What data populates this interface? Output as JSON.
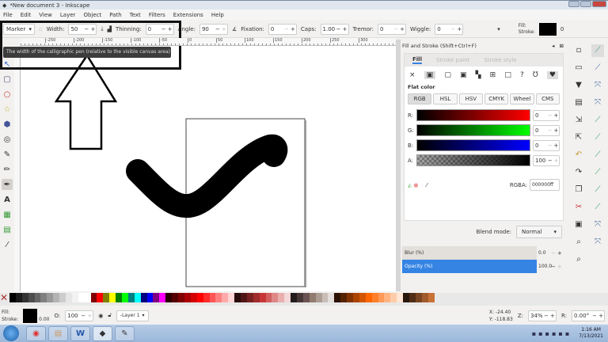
{
  "window": {
    "title": "*New document 3 - Inkscape"
  },
  "menu": [
    "File",
    "Edit",
    "View",
    "Layer",
    "Object",
    "Path",
    "Text",
    "Filters",
    "Extensions",
    "Help"
  ],
  "toolbar": {
    "preset": "Marker",
    "width_label": "Width:",
    "width": "50",
    "thinning_label": "Thinning:",
    "thinning": "0",
    "angle_label": "Angle:",
    "angle": "90",
    "fixation_label": "Fixation:",
    "fixation": "0",
    "caps_label": "Caps:",
    "caps": "1.00",
    "tremor_label": "Tremor:",
    "tremor": "0",
    "wiggle_label": "Wiggle:",
    "wiggle": "0",
    "fill_label": "Fill:",
    "stroke_label": "Stroke:",
    "stroke_value": "0"
  },
  "tooltip": "The width of the calligraphic pen (relative to the visible canvas area)",
  "ruler_ticks": [
    "-250",
    "-200",
    "-150",
    "-100",
    "-50",
    "0",
    "50",
    "100",
    "150",
    "200",
    "250",
    "300"
  ],
  "dock": {
    "title": "Fill and Stroke (Shift+Ctrl+F)",
    "tabs": [
      "Fill",
      "Stroke paint",
      "Stroke style"
    ],
    "paint_types": [
      "×",
      "flat",
      "linear",
      "radial",
      "mesh",
      "pattern",
      "swatch",
      "?",
      "unset-evenodd",
      "unset-nonzero"
    ],
    "flat_color": "Flat color",
    "modes": [
      "RGB",
      "HSL",
      "HSV",
      "CMYK",
      "Wheel",
      "CMS"
    ],
    "channels": [
      {
        "label": "R:",
        "value": "0",
        "color": "#ff0000"
      },
      {
        "label": "G:",
        "value": "0",
        "color": "#00ff00"
      },
      {
        "label": "B:",
        "value": "0",
        "color": "#0000ff"
      },
      {
        "label": "A:",
        "value": "100",
        "color": "#000000"
      }
    ],
    "rgba_label": "RGBA:",
    "rgba": "000000ff",
    "blend_label": "Blend mode:",
    "blend": "Normal",
    "blur_label": "Blur (%)",
    "blur": "0.0",
    "opacity_label": "Opacity (%)",
    "opacity": "100.0",
    "accent": "#3584e4"
  },
  "palette": [
    "#000000",
    "#1a1a1a",
    "#333333",
    "#4d4d4d",
    "#666666",
    "#808080",
    "#999999",
    "#b3b3b3",
    "#cccccc",
    "#e6e6e6",
    "#f2f2f2",
    "#ffffff",
    "#ffffff",
    "#800000",
    "#ff0000",
    "#808000",
    "#ffff00",
    "#008000",
    "#00ff00",
    "#008080",
    "#00ffff",
    "#000080",
    "#0000ff",
    "#800080",
    "#ff00ff",
    "#2b0000",
    "#550000",
    "#800000",
    "#aa0000",
    "#d40000",
    "#ff0000",
    "#ff2a2a",
    "#ff5555",
    "#ff8080",
    "#ffaaaa",
    "#ffd5d5",
    "#280b0b",
    "#501616",
    "#782121",
    "#a02c2c",
    "#c83737",
    "#d35f5f",
    "#de8787",
    "#e9afaf",
    "#f4d7d7",
    "#241c1c",
    "#483737",
    "#6c5353",
    "#917c6f",
    "#ac9d93",
    "#c8beb7",
    "#e3dedb",
    "#2b1100",
    "#552200",
    "#803300",
    "#aa4400",
    "#d45500",
    "#ff6600",
    "#ff7f2a",
    "#ff9955",
    "#ffb380",
    "#ffccaa",
    "#ffe6d5",
    "#28170b",
    "#502d16",
    "#784421",
    "#a05a2c",
    "#c87137"
  ],
  "status": {
    "fill_label": "Fill:",
    "stroke_label": "Stroke:",
    "stroke_width": "0.00",
    "opacity_label": "O:",
    "opacity": "100",
    "layer": "-Layer 1",
    "x_label": "X:",
    "x": "-24.40",
    "y_label": "Y:",
    "y": "-118.83",
    "zoom_label": "Z:",
    "zoom": "34%",
    "rotate_label": "R:",
    "rotate": "0.00°"
  },
  "taskbar": {
    "time": "1:16 AM",
    "date": "7/13/2021",
    "apps": [
      "start",
      "chrome",
      "explorer",
      "word",
      "inkscape",
      "paint"
    ]
  }
}
